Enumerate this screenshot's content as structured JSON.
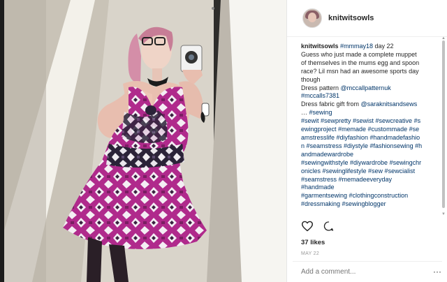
{
  "post": {
    "username": "knitwitsowls",
    "caption_lines": [
      [
        {
          "t": "knitwitsowls ",
          "c": "u"
        },
        {
          "t": "#mmmay18",
          "c": "tag"
        },
        {
          "t": " day 22",
          "c": ""
        }
      ],
      [
        {
          "t": "Guess who just made a complete muppet",
          "c": ""
        }
      ],
      [
        {
          "t": "of themselves in the mums egg and spoon",
          "c": ""
        }
      ],
      [
        {
          "t": "race? Lil msn had an awesome sports day",
          "c": ""
        }
      ],
      [
        {
          "t": "though",
          "c": ""
        }
      ],
      [
        {
          "t": "Dress pattern ",
          "c": ""
        },
        {
          "t": "@mccallpatternuk",
          "c": "tag"
        }
      ],
      [
        {
          "t": "#mccalls7381",
          "c": "tag"
        }
      ],
      [
        {
          "t": "Dress fabric gift from ",
          "c": ""
        },
        {
          "t": "@saraknitsandsews",
          "c": "tag"
        }
      ],
      [
        {
          "t": "… ",
          "c": ""
        },
        {
          "t": "#sewing",
          "c": "tag"
        }
      ],
      [
        {
          "t": "#sewit #sewpretty #sewist #sewcreative #s",
          "c": "tag"
        }
      ],
      [
        {
          "t": "ewingproject #memade #custommade #se",
          "c": "tag"
        }
      ],
      [
        {
          "t": "amstresslife #diyfashion #handmadefashio",
          "c": "tag"
        }
      ],
      [
        {
          "t": "n #seamstress #diystyle #fashionsewing #h",
          "c": "tag"
        }
      ],
      [
        {
          "t": "andmadewardrobe",
          "c": "tag"
        }
      ],
      [
        {
          "t": "#sewingwithstyle #diywardrobe #sewingchr",
          "c": "tag"
        }
      ],
      [
        {
          "t": "onicles #sewinglifestyle #sew #sewcialist",
          "c": "tag"
        }
      ],
      [
        {
          "t": "#seamstress #memadeeveryday",
          "c": "tag"
        }
      ],
      [
        {
          "t": "#handmade",
          "c": "tag"
        }
      ],
      [
        {
          "t": "#garmentsewing #clothingconstruction",
          "c": "tag"
        }
      ],
      [
        {
          "t": "#dressmaking #sewingblogger",
          "c": "tag"
        }
      ]
    ],
    "likes": "37 likes",
    "date": "MAY 22",
    "comment_placeholder": "Add a comment...",
    "more_glyph": "···"
  },
  "icons": [
    "heart-icon",
    "comment-icon",
    "more-options-icon",
    "avatar"
  ],
  "colors": {
    "text": "#262626",
    "hashtag": "#003569",
    "muted": "#999999",
    "divider": "#efefef"
  }
}
